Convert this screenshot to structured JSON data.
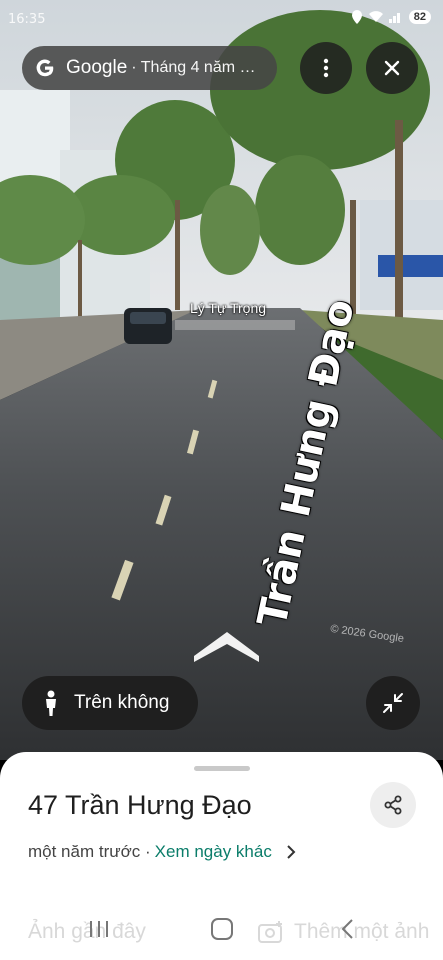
{
  "status_bar": {
    "time": "16:35",
    "battery": "82"
  },
  "top_bar": {
    "brand": "Google",
    "subtitle": "· Tháng 4 năm …"
  },
  "scene": {
    "cross_street": "Lý Tự Trọng",
    "road_name": "Trần Hưng Đạo",
    "copyright": "© 2026 Google"
  },
  "sky_view_button": {
    "label": "Trên không"
  },
  "place_sheet": {
    "address": "47 Trần Hưng Đạo",
    "age": "một năm trước ·",
    "other_dates_link": "Xem ngày khác",
    "recent_photos": "Ảnh gần đây",
    "add_photo": "Thêm một ảnh"
  },
  "colors": {
    "link": "#0b7d6a",
    "sheet_bg": "#ffffff",
    "pill_bg": "#464646"
  },
  "icons": [
    "google-g-icon",
    "more-vert-icon",
    "close-icon",
    "person-icon",
    "collapse-icon",
    "share-icon",
    "chevron-right-icon",
    "recent-apps-icon",
    "home-icon",
    "back-icon"
  ]
}
